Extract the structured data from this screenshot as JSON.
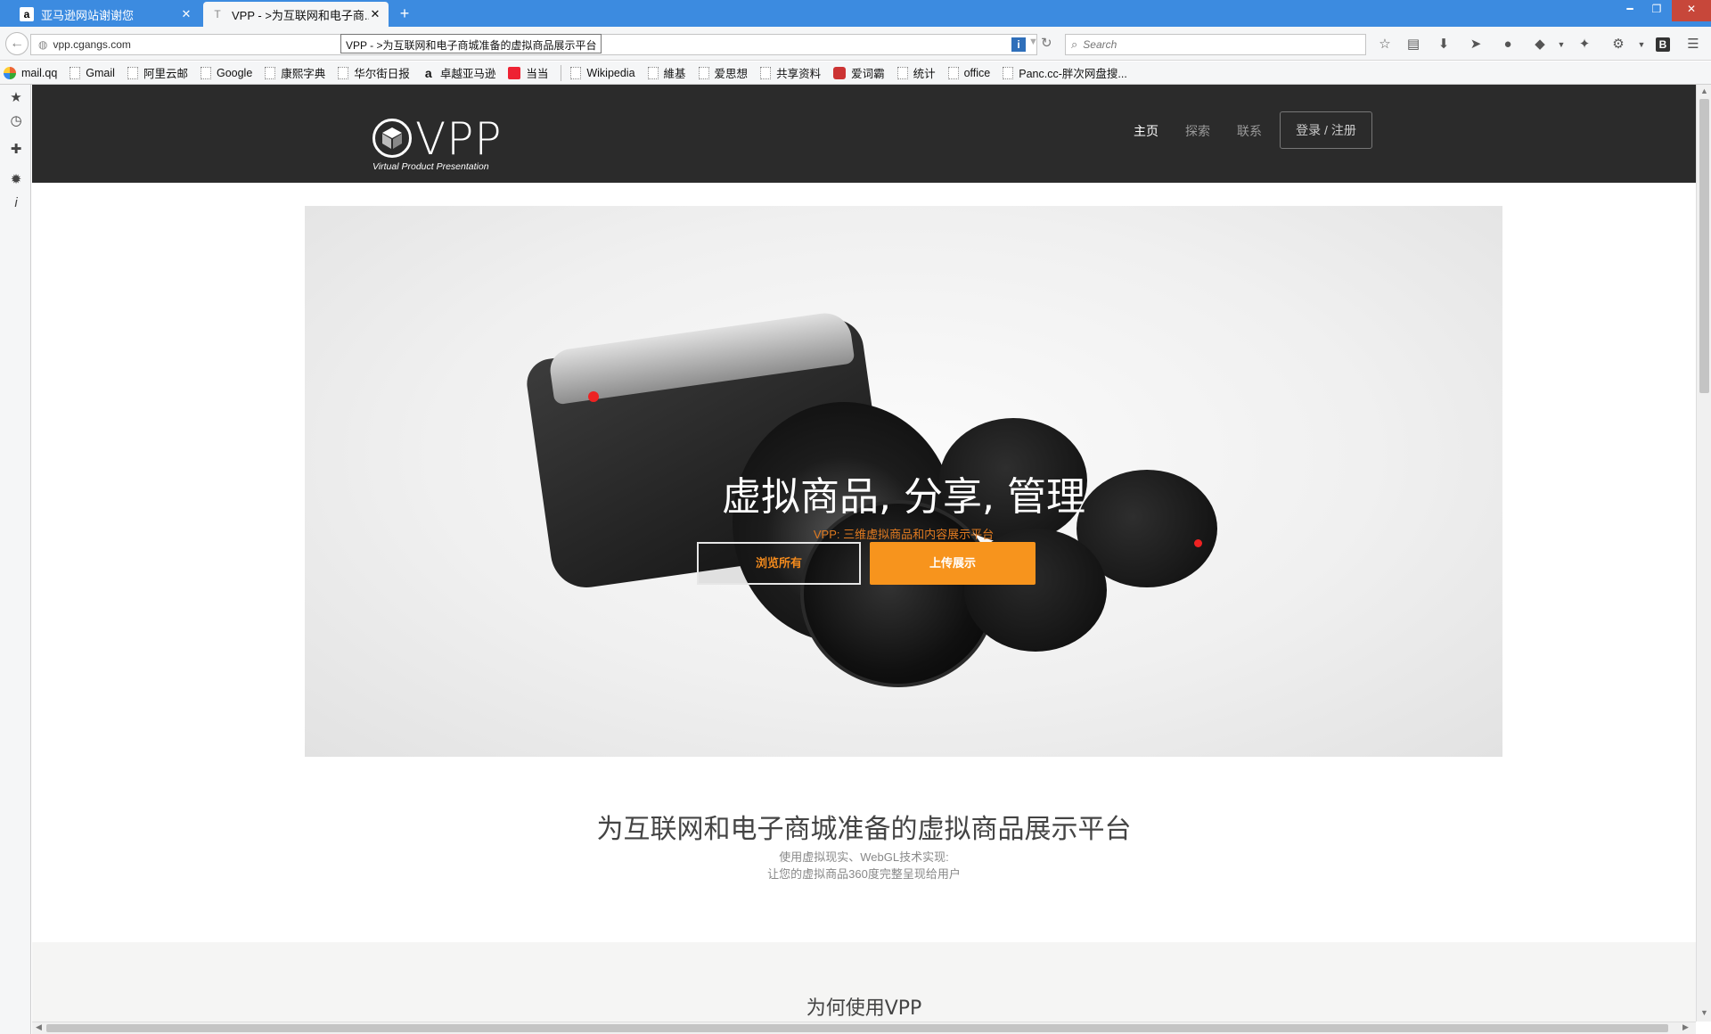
{
  "browser": {
    "tabs": [
      {
        "label": "亚马逊网站谢谢您",
        "favicon": "a"
      },
      {
        "label": "VPP - >为互联网和电子商...",
        "favicon": "T"
      }
    ],
    "new_tab_symbol": "+",
    "url": "vpp.cgangs.com",
    "tooltip": "VPP - >为互联网和电子商城准备的虚拟商品展示平台",
    "search_placeholder": "Search",
    "bookmarks": [
      "mail.qq",
      "Gmail",
      "阿里云邮",
      "Google",
      "康熙字典",
      "华尔街日报",
      "卓越亚马逊",
      "当当",
      "Wikipedia",
      "維基",
      "爱思想",
      "共享资料",
      "爱词霸",
      "统计",
      "office",
      "Panc.cc-胖次网盘搜..."
    ]
  },
  "site": {
    "logo_text": "VPP",
    "logo_sub": "Virtual Product Presentation",
    "nav": [
      "主页",
      "探索",
      "联系"
    ],
    "login": "登录 / 注册"
  },
  "hero": {
    "title": "虚拟商品, 分享, 管理",
    "subtitle": "VPP: 三维虚拟商品和内容展示平台",
    "browse_label": "浏览所有",
    "upload_label": "上传展示"
  },
  "intro": {
    "tagline": "为互联网和电子商城准备的虚拟商品展示平台",
    "line1": "使用虚拟现实、WebGL技术实现:",
    "line2": "让您的虚拟商品360度完整呈现给用户"
  },
  "why": {
    "title": "为何使用VPP"
  },
  "colors": {
    "accent": "#f7941d",
    "header_bg": "#2b2b2b",
    "tab_strip": "#3c8be0"
  }
}
